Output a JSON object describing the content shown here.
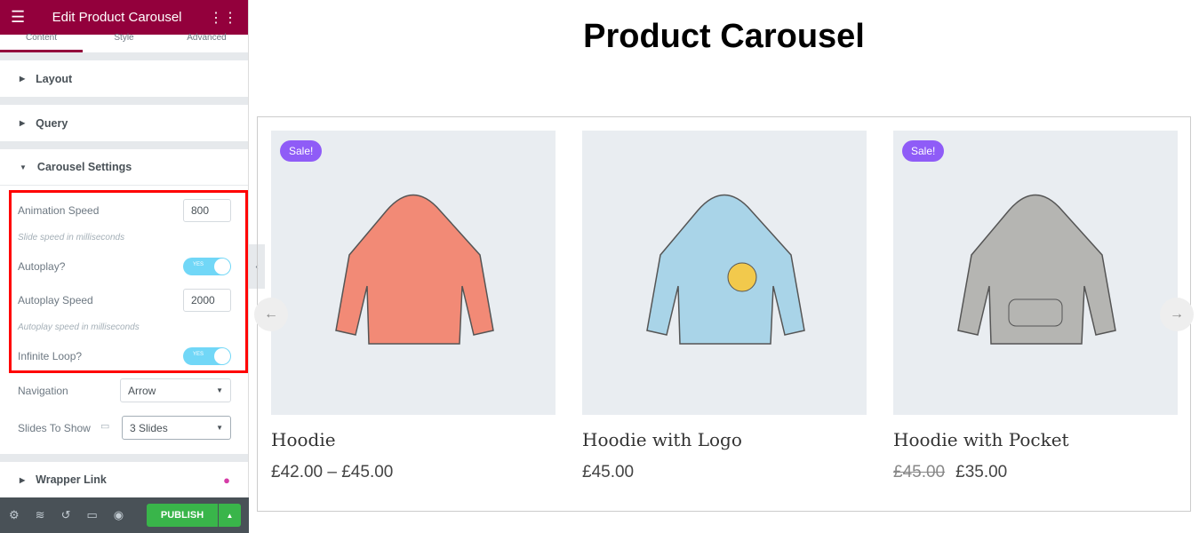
{
  "panel": {
    "title": "Edit Product Carousel",
    "tabs": [
      "Content",
      "Style",
      "Advanced"
    ],
    "sections": {
      "layout": "Layout",
      "query": "Query",
      "carousel": "Carousel Settings",
      "wrapper": "Wrapper Link"
    },
    "controls": {
      "animation_speed_label": "Animation Speed",
      "animation_speed": "800",
      "animation_speed_desc": "Slide speed in milliseconds",
      "autoplay_label": "Autoplay?",
      "autoplay_state": "YES",
      "autoplay_speed_label": "Autoplay Speed",
      "autoplay_speed": "2000",
      "autoplay_speed_desc": "Autoplay speed in milliseconds",
      "infinite_label": "Infinite Loop?",
      "infinite_state": "YES",
      "navigation_label": "Navigation",
      "navigation": "Arrow",
      "slides_label": "Slides To Show",
      "slides": "3 Slides"
    },
    "publish": "PUBLISH"
  },
  "page": {
    "title": "Product Carousel",
    "products": [
      {
        "name": "Hoodie",
        "price": "£42.00 – £45.00",
        "sale": "Sale!",
        "color": "#f28a76"
      },
      {
        "name": "Hoodie with Logo",
        "price": "£45.00",
        "color": "#a9d4e8"
      },
      {
        "name": "Hoodie with Pocket",
        "old_price": "£45.00",
        "price": "£35.00",
        "sale": "Sale!",
        "color": "#b5b5b2"
      }
    ]
  }
}
